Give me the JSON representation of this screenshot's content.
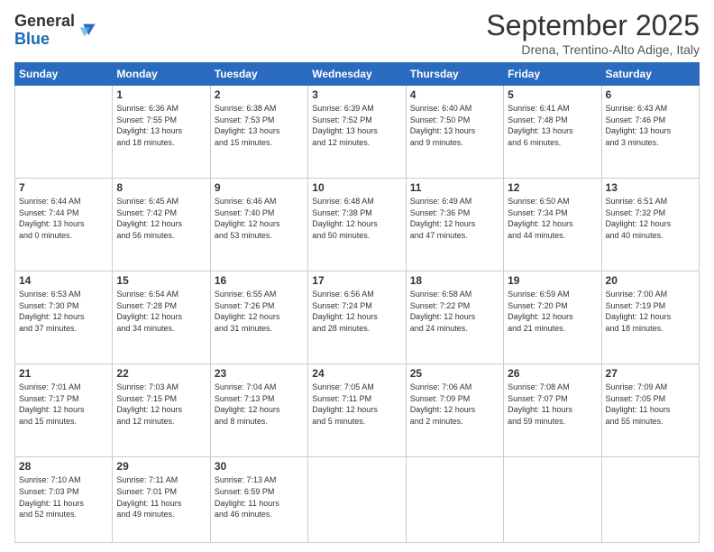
{
  "logo": {
    "general": "General",
    "blue": "Blue"
  },
  "header": {
    "month": "September 2025",
    "location": "Drena, Trentino-Alto Adige, Italy"
  },
  "weekdays": [
    "Sunday",
    "Monday",
    "Tuesday",
    "Wednesday",
    "Thursday",
    "Friday",
    "Saturday"
  ],
  "weeks": [
    [
      {
        "day": "",
        "info": ""
      },
      {
        "day": "1",
        "info": "Sunrise: 6:36 AM\nSunset: 7:55 PM\nDaylight: 13 hours\nand 18 minutes."
      },
      {
        "day": "2",
        "info": "Sunrise: 6:38 AM\nSunset: 7:53 PM\nDaylight: 13 hours\nand 15 minutes."
      },
      {
        "day": "3",
        "info": "Sunrise: 6:39 AM\nSunset: 7:52 PM\nDaylight: 13 hours\nand 12 minutes."
      },
      {
        "day": "4",
        "info": "Sunrise: 6:40 AM\nSunset: 7:50 PM\nDaylight: 13 hours\nand 9 minutes."
      },
      {
        "day": "5",
        "info": "Sunrise: 6:41 AM\nSunset: 7:48 PM\nDaylight: 13 hours\nand 6 minutes."
      },
      {
        "day": "6",
        "info": "Sunrise: 6:43 AM\nSunset: 7:46 PM\nDaylight: 13 hours\nand 3 minutes."
      }
    ],
    [
      {
        "day": "7",
        "info": "Sunrise: 6:44 AM\nSunset: 7:44 PM\nDaylight: 13 hours\nand 0 minutes."
      },
      {
        "day": "8",
        "info": "Sunrise: 6:45 AM\nSunset: 7:42 PM\nDaylight: 12 hours\nand 56 minutes."
      },
      {
        "day": "9",
        "info": "Sunrise: 6:46 AM\nSunset: 7:40 PM\nDaylight: 12 hours\nand 53 minutes."
      },
      {
        "day": "10",
        "info": "Sunrise: 6:48 AM\nSunset: 7:38 PM\nDaylight: 12 hours\nand 50 minutes."
      },
      {
        "day": "11",
        "info": "Sunrise: 6:49 AM\nSunset: 7:36 PM\nDaylight: 12 hours\nand 47 minutes."
      },
      {
        "day": "12",
        "info": "Sunrise: 6:50 AM\nSunset: 7:34 PM\nDaylight: 12 hours\nand 44 minutes."
      },
      {
        "day": "13",
        "info": "Sunrise: 6:51 AM\nSunset: 7:32 PM\nDaylight: 12 hours\nand 40 minutes."
      }
    ],
    [
      {
        "day": "14",
        "info": "Sunrise: 6:53 AM\nSunset: 7:30 PM\nDaylight: 12 hours\nand 37 minutes."
      },
      {
        "day": "15",
        "info": "Sunrise: 6:54 AM\nSunset: 7:28 PM\nDaylight: 12 hours\nand 34 minutes."
      },
      {
        "day": "16",
        "info": "Sunrise: 6:55 AM\nSunset: 7:26 PM\nDaylight: 12 hours\nand 31 minutes."
      },
      {
        "day": "17",
        "info": "Sunrise: 6:56 AM\nSunset: 7:24 PM\nDaylight: 12 hours\nand 28 minutes."
      },
      {
        "day": "18",
        "info": "Sunrise: 6:58 AM\nSunset: 7:22 PM\nDaylight: 12 hours\nand 24 minutes."
      },
      {
        "day": "19",
        "info": "Sunrise: 6:59 AM\nSunset: 7:20 PM\nDaylight: 12 hours\nand 21 minutes."
      },
      {
        "day": "20",
        "info": "Sunrise: 7:00 AM\nSunset: 7:19 PM\nDaylight: 12 hours\nand 18 minutes."
      }
    ],
    [
      {
        "day": "21",
        "info": "Sunrise: 7:01 AM\nSunset: 7:17 PM\nDaylight: 12 hours\nand 15 minutes."
      },
      {
        "day": "22",
        "info": "Sunrise: 7:03 AM\nSunset: 7:15 PM\nDaylight: 12 hours\nand 12 minutes."
      },
      {
        "day": "23",
        "info": "Sunrise: 7:04 AM\nSunset: 7:13 PM\nDaylight: 12 hours\nand 8 minutes."
      },
      {
        "day": "24",
        "info": "Sunrise: 7:05 AM\nSunset: 7:11 PM\nDaylight: 12 hours\nand 5 minutes."
      },
      {
        "day": "25",
        "info": "Sunrise: 7:06 AM\nSunset: 7:09 PM\nDaylight: 12 hours\nand 2 minutes."
      },
      {
        "day": "26",
        "info": "Sunrise: 7:08 AM\nSunset: 7:07 PM\nDaylight: 11 hours\nand 59 minutes."
      },
      {
        "day": "27",
        "info": "Sunrise: 7:09 AM\nSunset: 7:05 PM\nDaylight: 11 hours\nand 55 minutes."
      }
    ],
    [
      {
        "day": "28",
        "info": "Sunrise: 7:10 AM\nSunset: 7:03 PM\nDaylight: 11 hours\nand 52 minutes."
      },
      {
        "day": "29",
        "info": "Sunrise: 7:11 AM\nSunset: 7:01 PM\nDaylight: 11 hours\nand 49 minutes."
      },
      {
        "day": "30",
        "info": "Sunrise: 7:13 AM\nSunset: 6:59 PM\nDaylight: 11 hours\nand 46 minutes."
      },
      {
        "day": "",
        "info": ""
      },
      {
        "day": "",
        "info": ""
      },
      {
        "day": "",
        "info": ""
      },
      {
        "day": "",
        "info": ""
      }
    ]
  ]
}
